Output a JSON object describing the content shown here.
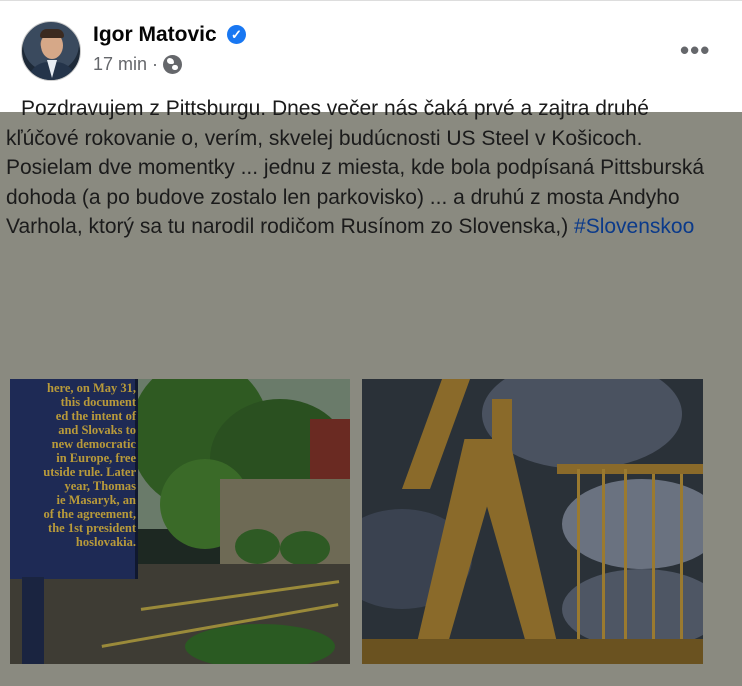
{
  "post": {
    "author": "Igor Matovic",
    "time": "17 min ·",
    "more_label": "•••",
    "verified_glyph": "✓",
    "text_line1": "Pozdravujem z Pittsburgu. Dnes večer nás čaká prvé a zajtra druhé",
    "text_rest": "kľúčové rokovanie o, verím, skvelej budúcnosti US Steel v Košicoch. Posielam dve momentky ... jednu z miesta, kde bola podpísaná Pittsburská dohoda (a po budove zostalo len parkovisko) ... a druhú z mosta Andyho Varhola, ktorý sa tu narodil rodičom Rusínom zo Slovenska,) ",
    "hashtag": "#Slovenskoo"
  },
  "photos": {
    "sign_lines": [
      "here, on May 31,",
      "this document",
      "ed the intent of",
      "and Slovaks to",
      "new democratic",
      "in Europe, free",
      "utside rule. Later",
      "year, Thomas",
      "ie Masaryk, an",
      "of the agreement,",
      "the 1st president",
      "hoslovakia."
    ]
  },
  "icons": {
    "verified": "verified-badge-icon",
    "globe": "globe-icon",
    "more": "more-options-icon"
  },
  "colors": {
    "overlay": "#8a8a80",
    "link": "#0b3a8a",
    "verified": "#1877f2"
  }
}
